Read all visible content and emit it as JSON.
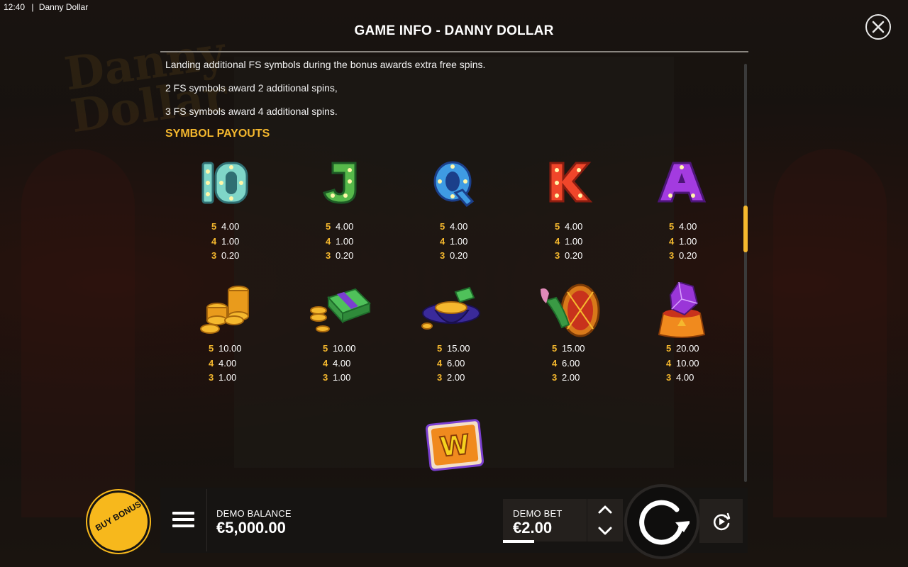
{
  "status_bar": {
    "time": "12:40",
    "separator": "|",
    "app_name": "Danny Dollar"
  },
  "dialog": {
    "title": "GAME INFO - DANNY DOLLAR",
    "close_icon": "close-icon",
    "paragraphs": [
      "Landing additional FS symbols during the bonus awards extra free spins.",
      "2 FS symbols award 2 additional spins,",
      "3 FS symbols award 4 additional spins."
    ],
    "section_title": "SYMBOL PAYOUTS",
    "symbols": [
      {
        "icon": "ten-symbol-icon",
        "payouts": [
          {
            "count": "5",
            "value": "4.00"
          },
          {
            "count": "4",
            "value": "1.00"
          },
          {
            "count": "3",
            "value": "0.20"
          }
        ]
      },
      {
        "icon": "j-symbol-icon",
        "payouts": [
          {
            "count": "5",
            "value": "4.00"
          },
          {
            "count": "4",
            "value": "1.00"
          },
          {
            "count": "3",
            "value": "0.20"
          }
        ]
      },
      {
        "icon": "q-symbol-icon",
        "payouts": [
          {
            "count": "5",
            "value": "4.00"
          },
          {
            "count": "4",
            "value": "1.00"
          },
          {
            "count": "3",
            "value": "0.20"
          }
        ]
      },
      {
        "icon": "k-symbol-icon",
        "payouts": [
          {
            "count": "5",
            "value": "4.00"
          },
          {
            "count": "4",
            "value": "1.00"
          },
          {
            "count": "3",
            "value": "0.20"
          }
        ]
      },
      {
        "icon": "a-symbol-icon",
        "payouts": [
          {
            "count": "5",
            "value": "4.00"
          },
          {
            "count": "4",
            "value": "1.00"
          },
          {
            "count": "3",
            "value": "0.20"
          }
        ]
      },
      {
        "icon": "coin-stack-icon",
        "payouts": [
          {
            "count": "5",
            "value": "10.00"
          },
          {
            "count": "4",
            "value": "4.00"
          },
          {
            "count": "3",
            "value": "1.00"
          }
        ]
      },
      {
        "icon": "cash-bundle-icon",
        "payouts": [
          {
            "count": "5",
            "value": "10.00"
          },
          {
            "count": "4",
            "value": "4.00"
          },
          {
            "count": "3",
            "value": "1.00"
          }
        ]
      },
      {
        "icon": "top-hat-icon",
        "payouts": [
          {
            "count": "5",
            "value": "15.00"
          },
          {
            "count": "4",
            "value": "6.00"
          },
          {
            "count": "3",
            "value": "2.00"
          }
        ]
      },
      {
        "icon": "drum-icon",
        "payouts": [
          {
            "count": "5",
            "value": "15.00"
          },
          {
            "count": "4",
            "value": "6.00"
          },
          {
            "count": "3",
            "value": "2.00"
          }
        ]
      },
      {
        "icon": "gem-pedestal-icon",
        "payouts": [
          {
            "count": "5",
            "value": "20.00"
          },
          {
            "count": "4",
            "value": "10.00"
          },
          {
            "count": "3",
            "value": "4.00"
          }
        ]
      }
    ],
    "wild_symbol": {
      "icon": "wild-symbol-icon",
      "letter": "W"
    }
  },
  "bottom_bar": {
    "buy_bonus_label": "BUY BONUS",
    "menu_icon": "menu-icon",
    "balance_label": "DEMO BALANCE",
    "balance_value": "€5,000.00",
    "bet_label": "DEMO BET",
    "bet_value": "€2.00",
    "bet_up_icon": "chevron-up-icon",
    "bet_down_icon": "chevron-down-icon",
    "spin_icon": "spin-icon",
    "autoplay_icon": "autoplay-icon"
  },
  "colors": {
    "accent": "#f5b82e",
    "panel": "#161412",
    "text": "#ffffff"
  }
}
